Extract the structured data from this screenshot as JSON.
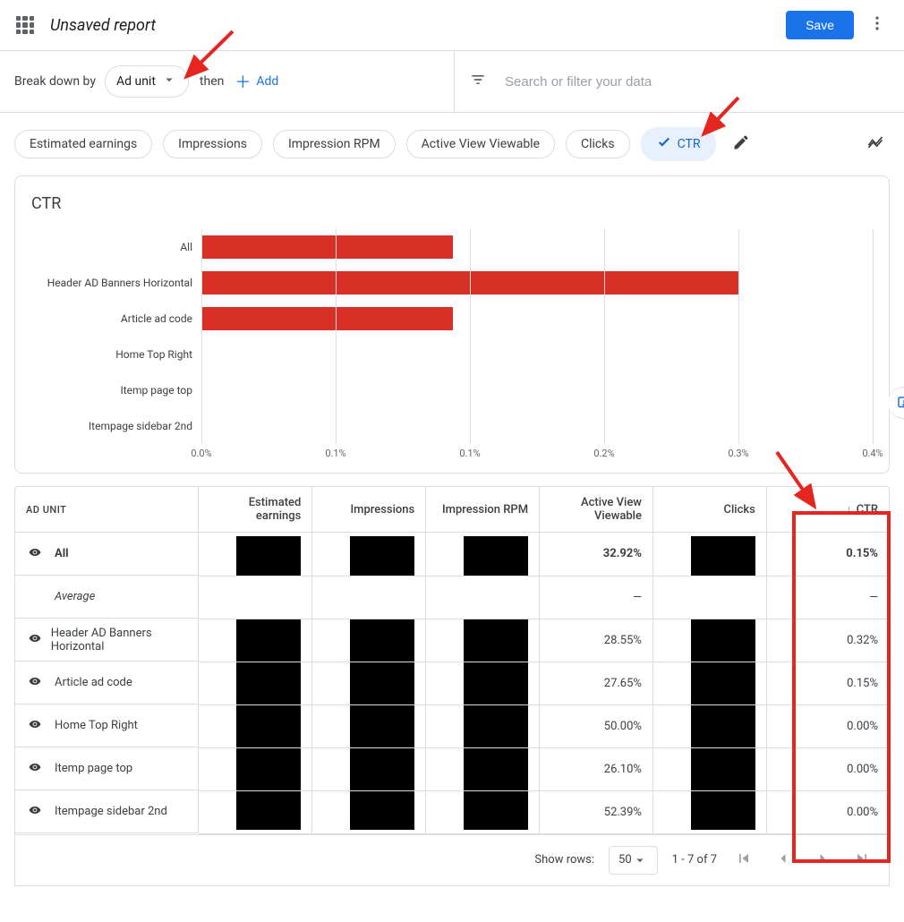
{
  "header": {
    "page_title": "Unsaved report",
    "save_label": "Save"
  },
  "controls": {
    "breakdown_label": "Break down by",
    "breakdown_value": "Ad unit",
    "then_label": "then",
    "add_label": "Add",
    "search_placeholder": "Search or filter your data"
  },
  "metrics": {
    "chips": [
      {
        "label": "Estimated earnings",
        "active": false
      },
      {
        "label": "Impressions",
        "active": false
      },
      {
        "label": "Impression RPM",
        "active": false
      },
      {
        "label": "Active View Viewable",
        "active": false
      },
      {
        "label": "Clicks",
        "active": false
      },
      {
        "label": "CTR",
        "active": true
      }
    ]
  },
  "chart_data": {
    "type": "bar",
    "title": "CTR",
    "xlabel": "",
    "ylabel": "",
    "xlim": [
      0,
      0.4
    ],
    "x_unit": "%",
    "ticks": [
      "0.0%",
      "0.1%",
      "0.1%",
      "0.2%",
      "0.3%",
      "0.4%"
    ],
    "series": [
      {
        "name": "All",
        "value": 0.15
      },
      {
        "name": "Header AD Banners Horizontal",
        "value": 0.32
      },
      {
        "name": "Article ad code",
        "value": 0.15
      },
      {
        "name": "Home Top Right",
        "value": 0.0
      },
      {
        "name": "Itemp page top",
        "value": 0.0
      },
      {
        "name": "Itempage sidebar 2nd",
        "value": 0.0
      }
    ]
  },
  "table": {
    "columns": [
      "AD UNIT",
      "Estimated earnings",
      "Impressions",
      "Impression RPM",
      "Active View Viewable",
      "Clicks",
      "CTR"
    ],
    "sort_column_index": 6,
    "sort_direction": "desc",
    "rows": [
      {
        "label": "All",
        "bold": true,
        "eye": true,
        "avv": "32.92%",
        "ctr": "0.15%"
      },
      {
        "label": "Average",
        "italic": true,
        "eye": false,
        "avv": "—",
        "ctr": "—"
      },
      {
        "label": "Header AD Banners Horizontal",
        "eye": true,
        "avv": "28.55%",
        "ctr": "0.32%"
      },
      {
        "label": "Article ad code",
        "eye": true,
        "avv": "27.65%",
        "ctr": "0.15%"
      },
      {
        "label": "Home Top Right",
        "eye": true,
        "avv": "50.00%",
        "ctr": "0.00%"
      },
      {
        "label": "Itemp page top",
        "eye": true,
        "avv": "26.10%",
        "ctr": "0.00%"
      },
      {
        "label": "Itempage sidebar 2nd",
        "eye": true,
        "avv": "52.39%",
        "ctr": "0.00%"
      }
    ]
  },
  "pager": {
    "show_rows_label": "Show rows:",
    "show_rows_value": "50",
    "range_text": "1 - 7 of 7"
  }
}
